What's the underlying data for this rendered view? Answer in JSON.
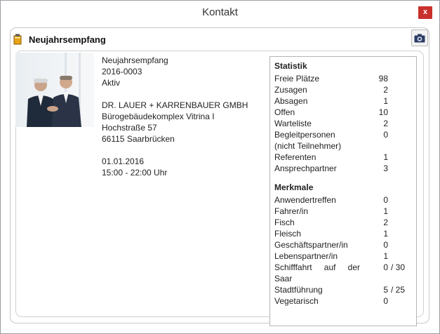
{
  "window": {
    "title": "Kontakt",
    "close_label": "x"
  },
  "event": {
    "title": "Neujahrsempfang",
    "details": [
      "Neujahrsempfang",
      "2016-0003",
      "Aktiv",
      "",
      "DR. LAUER + KARRENBAUER GMBH",
      "Bürogebäudekomplex Vitrina I",
      "Hochstraße 57",
      "66115 Saarbrücken",
      "",
      "01.01.2016",
      "15:00 - 22:00 Uhr"
    ]
  },
  "statistik": {
    "heading": "Statistik",
    "rows": [
      {
        "label": "Freie Plätze",
        "value": "98"
      },
      {
        "label": "Zusagen",
        "value": "2"
      },
      {
        "label": "Absagen",
        "value": "1"
      },
      {
        "label": "Offen",
        "value": "10"
      },
      {
        "label": "Warteliste",
        "value": "2"
      },
      {
        "label": "Begleitpersonen",
        "value": "0"
      },
      {
        "label": "(nicht Teilnehmer)",
        "value": ""
      },
      {
        "label": "Referenten",
        "value": "1"
      },
      {
        "label": "Ansprechpartner",
        "value": "3"
      }
    ]
  },
  "merkmale": {
    "heading": "Merkmale",
    "rows": [
      {
        "label": "Anwendertreffen",
        "value": "0"
      },
      {
        "label": "Fahrer/in",
        "value": "1"
      },
      {
        "label": "Fisch",
        "value": "2"
      },
      {
        "label": "Fleisch",
        "value": "1"
      },
      {
        "label": "Geschäftspartner/in",
        "value": "0"
      },
      {
        "label": "Lebenspartner/in",
        "value": "1"
      },
      {
        "label": "Schifffahrt auf der",
        "value": "0",
        "total": "/ 30"
      },
      {
        "label": "Saar",
        "value": ""
      },
      {
        "label": "Stadtführung",
        "value": "5",
        "total": "/ 25"
      },
      {
        "label": "Vegetarisch",
        "value": "0"
      }
    ]
  }
}
